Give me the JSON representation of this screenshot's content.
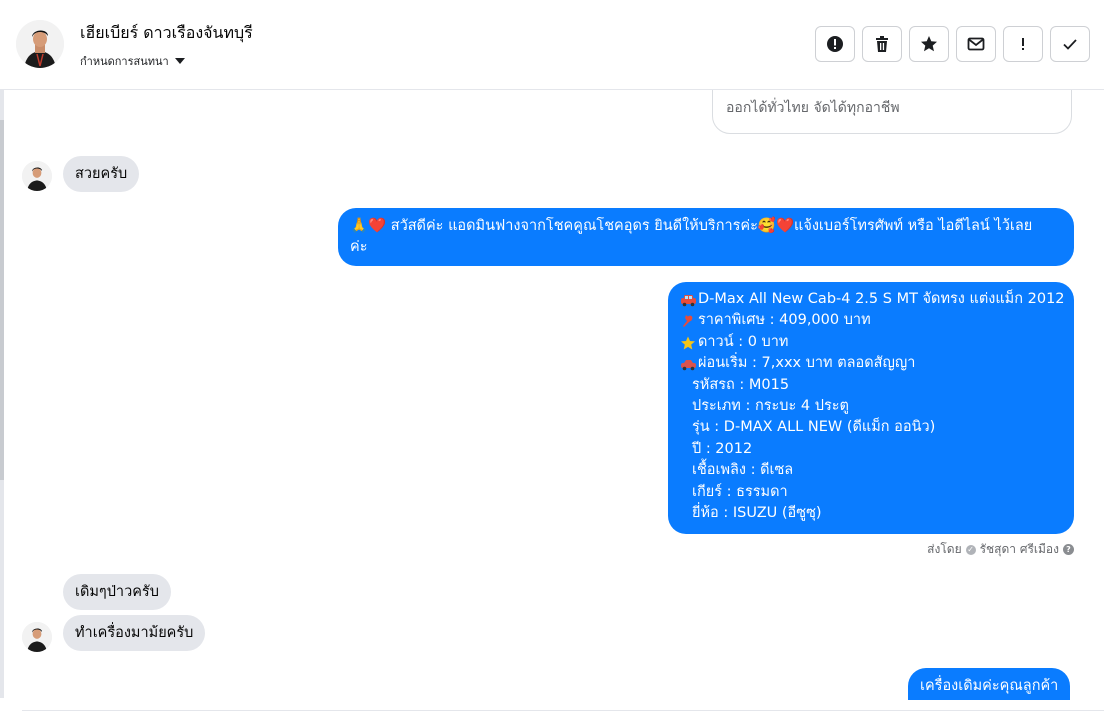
{
  "header": {
    "contact_name": "เฮียเบียร์ ดาวเรืองจันทบุรี",
    "conversation_setting": "กำหนดการสนทนา",
    "actions": [
      {
        "icon": "alert-circle-icon",
        "label": "spam"
      },
      {
        "icon": "trash-icon",
        "label": "delete"
      },
      {
        "icon": "star-icon",
        "label": "star"
      },
      {
        "icon": "mail-icon",
        "label": "mark-unread"
      },
      {
        "icon": "exclamation-icon",
        "label": "follow-up"
      },
      {
        "icon": "check-icon",
        "label": "done"
      }
    ]
  },
  "cut_card": {
    "subtitle": "ออกได้ทั่วไทย จัดได้ทุกอาชีพ"
  },
  "messages": {
    "in1": "สวยครับ",
    "greeting": {
      "emoji": "🙏❤️",
      "text": "สวัสดีค่ะ แอดมินฟางจากโชคคูณโชคอุดร ยินดีให้บริการค่ะ🥰❤️แจ้งเบอร์โทรศัพท์ หรือ ไอดีไลน์  ไว้เลย",
      "text2": "ค่ะ"
    },
    "spec": {
      "title": "D-Max All New Cab-4 2.5 S MT จัดทรง แต่งแม็ก 2012",
      "price": "ราคาพิเศษ : 409,000 บาท",
      "down": "ดาวน์ : 0 บาท",
      "installment": "ผ่อนเริ่ม : 7,xxx บาท ตลอดสัญญา",
      "code": "รหัสรถ : M015",
      "type": "ประเภท : กระบะ 4 ประตู",
      "model": "รุ่น : D-MAX ALL NEW (ดีแม็ก ออนิว)",
      "year": "ปี : 2012",
      "fuel": "เชื้อเพลิง : ดีเซล",
      "gear": "เกียร์ : ธรรมดา",
      "brand": "ยี่ห้อ : ISUZU (อีซูซุ)"
    },
    "sent_by_label": "ส่งโดย",
    "sent_by_name": "รัชสุดา ศรีเมือง",
    "in2": "เดิมๆป่าวครับ",
    "in3": "ทำเครื่องมาม้ยครับ",
    "last_out": "เครื่องเดิมค่ะคุณลูกค้า"
  },
  "colors": {
    "outgoing": "#0a7cff",
    "incoming": "#e4e6eb",
    "border": "#ced0d4"
  }
}
